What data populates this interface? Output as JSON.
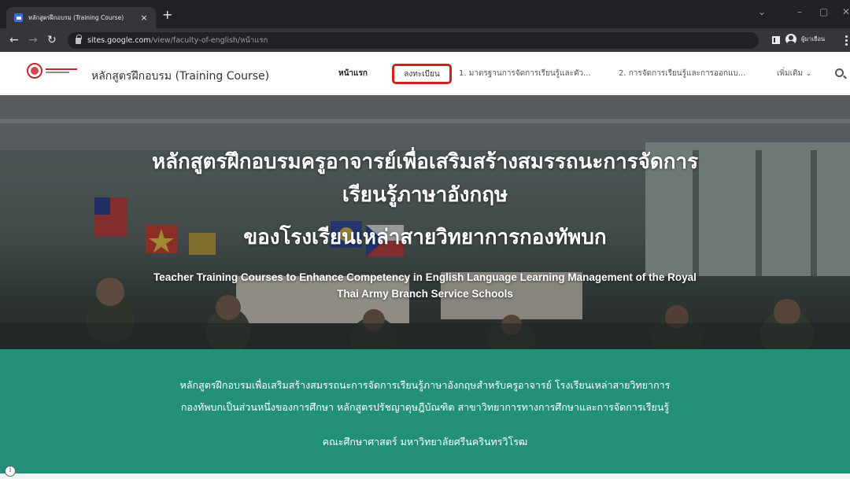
{
  "browser": {
    "tab_title": "หลักสูตรฝึกอบรม (Training Course)",
    "tab_close": "×",
    "new_tab": "+",
    "url_host": "sites.google.com",
    "url_path": "/view/faculty-of-english/หน้าแรก",
    "profile_label": "ผู้มาเยือน",
    "icons": [
      "google-sites-favicon",
      "back-arrow",
      "forward-arrow",
      "reload",
      "lock",
      "side-panel",
      "profile-avatar",
      "kebab-menu"
    ]
  },
  "header": {
    "site_name": "หลักสูตรฝึกอบรม (Training Course)",
    "nav": {
      "home": "หน้าแรก",
      "register": "ลงทะเบียน",
      "item1": "1. มาตรฐานการจัดการเรียนรู้และตัว...",
      "item2": "2. การจัดการเรียนรู้และการออกแบ...",
      "more": "เพิ่มเติม ⌄"
    },
    "highlight_color": "#d11f1f"
  },
  "hero": {
    "title_line1": "หลักสูตรฝึกอบรมครูอาจารย์เพื่อเสริมสร้างสมรรถนะการจัดการ",
    "title_line2": "เรียนรู้ภาษาอังกฤษ",
    "title_line3": "ของโรงเรียนเหล่าสายวิทยาการกองทัพบก",
    "subtitle_line1": "Teacher Training Courses to Enhance Competency in English Language Learning Management of the Royal",
    "subtitle_line2": "Thai Army Branch Service Schools"
  },
  "description": {
    "line1": "หลักสูตรฝึกอบรมเพื่อเสริมสร้างสมรรถนะการจัดการเรียนรู้ภาษาอังกฤษสำหรับครูอาจารย์ โรงเรียนเหล่าสายวิทยาการ",
    "line2": "กองทัพบกเป็นส่วนหนึ่งของการศึกษา หลักสูตรปรัชญาดุษฎีบัณฑิต สาขาวิทยาการทางการศึกษาและการจัดการเรียนรู้",
    "line3": "คณะศึกษาศาสตร์ มหาวิทยาลัยศรีนครินทรวิโรฒ",
    "background_color": "#23907a"
  }
}
